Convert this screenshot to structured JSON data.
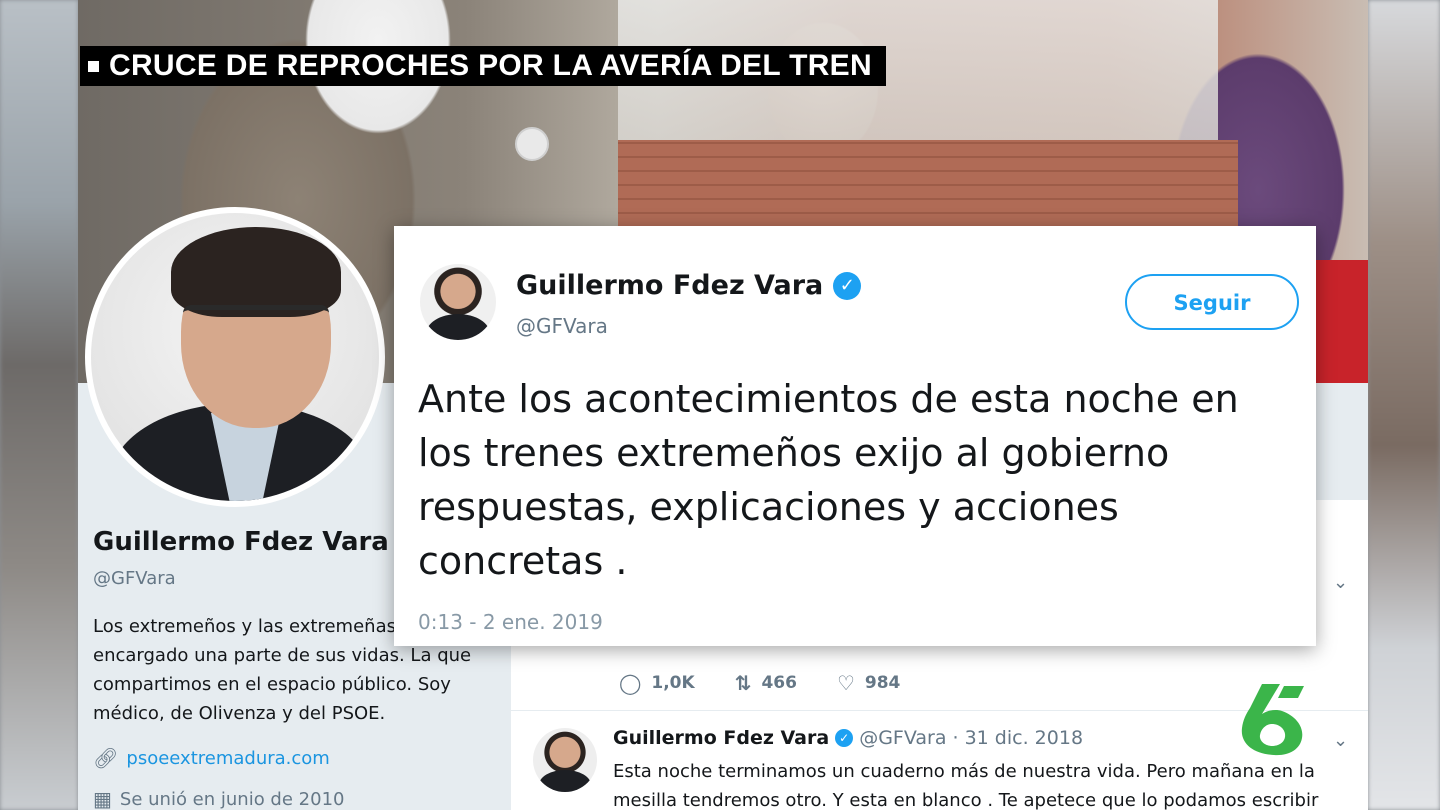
{
  "news": {
    "headline": "CRUCE DE REPROCHES POR LA AVERÍA DEL TREN"
  },
  "profile": {
    "name": "Guillermo Fdez Vara",
    "handle": "@GFVara",
    "bio_lines": [
      "Los extremeños y las extremeñas",
      "encargado una parte de sus vidas. La que",
      "compartimos en el espacio público. Soy",
      "médico, de Olivenza y del PSOE."
    ],
    "link": "psoeextremadura.com",
    "joined": "Se unió en junio de 2010"
  },
  "featured_tweet": {
    "author": "Guillermo Fdez Vara",
    "handle": "@GFVara",
    "follow_label": "Seguir",
    "text_lines": [
      "Ante los acontecimientos de esta noche en",
      "los trenes extremeños exijo al gobierno",
      "respuestas, explicaciones y acciones",
      "concretas ."
    ],
    "timestamp": "0:13 - 2 ene. 2019"
  },
  "timeline": {
    "actions": {
      "replies": "1,0K",
      "retweets": "466",
      "likes": "984"
    },
    "tweet2": {
      "author": "Guillermo Fdez Vara",
      "handle_date": "@GFVara · 31 dic. 2018",
      "text_lines": [
        "Esta noche terminamos un cuaderno más de nuestra vida. Pero mañana en la",
        "mesilla tendremos otro. Y esta en blanco . Te apetece que lo podamos escribir"
      ]
    }
  },
  "colors": {
    "twitter_blue": "#1da1f2",
    "logo_green": "#3bb54a"
  },
  "icons": {
    "verified": "verified-badge-icon",
    "link": "link-icon",
    "calendar": "calendar-icon",
    "reply": "reply-icon",
    "retweet": "retweet-icon",
    "like": "heart-icon",
    "caret": "chevron-down-icon",
    "channel": "la-sexta-logo"
  }
}
